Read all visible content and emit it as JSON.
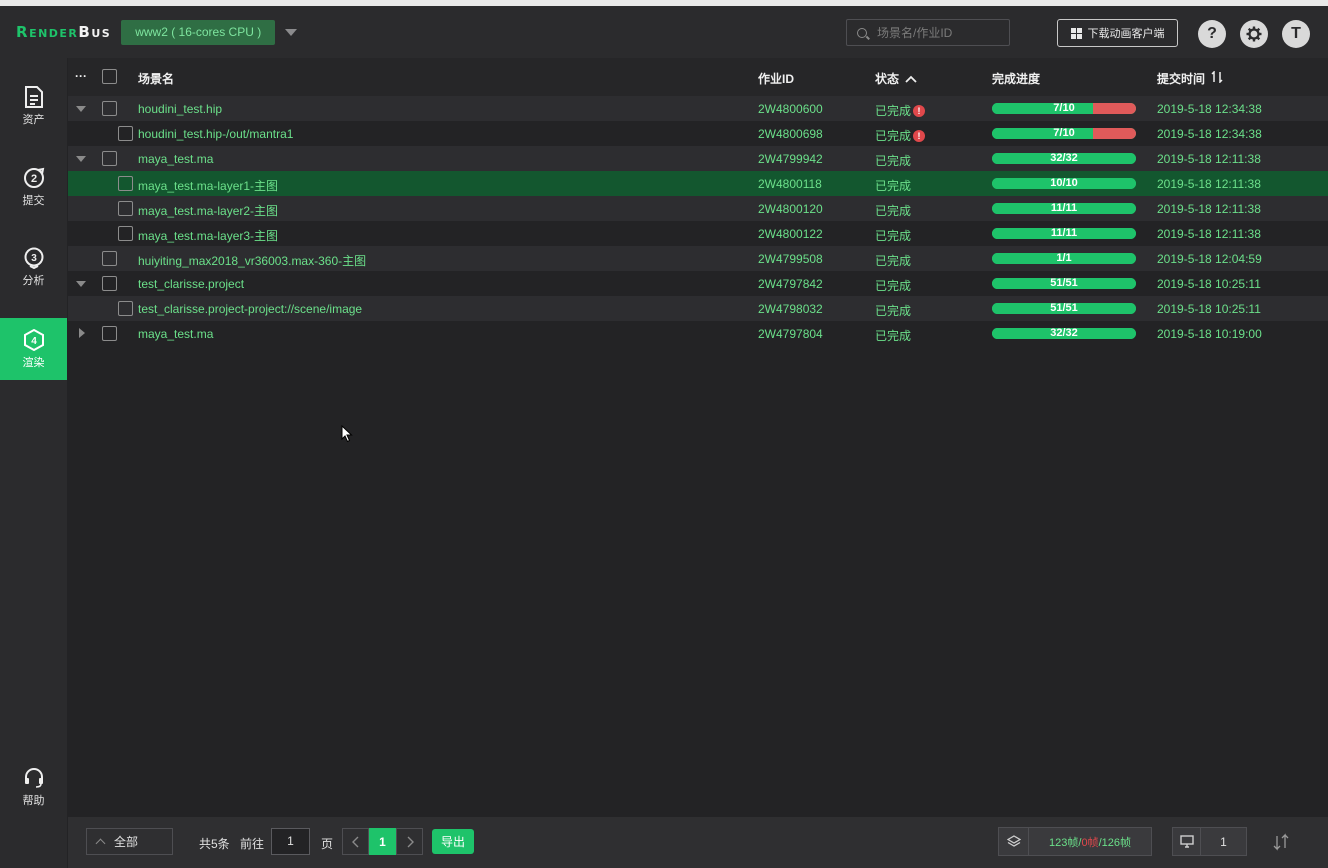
{
  "header": {
    "logo": {
      "r": "R",
      "ender": "ENDER",
      "b": "B",
      "us": "US"
    },
    "node_label": "www2 ( 16-cores CPU )",
    "search_placeholder": "场景名/作业ID",
    "download_label": "下载动画客户端",
    "help_label": "?",
    "avatar_label": "T"
  },
  "sidebar": {
    "items": [
      {
        "label": "资产",
        "icon": "asset-icon"
      },
      {
        "label": "提交",
        "icon": "submit-icon"
      },
      {
        "label": "分析",
        "icon": "analyze-icon"
      },
      {
        "label": "渲染",
        "icon": "render-icon",
        "active": true
      }
    ],
    "help": {
      "label": "帮助",
      "icon": "headset-icon"
    }
  },
  "table": {
    "columns": {
      "more": "···",
      "name": "场景名",
      "job_id": "作业ID",
      "status": "状态",
      "progress": "完成进度",
      "time": "提交时间"
    },
    "rows": [
      {
        "expand": "down",
        "indent": false,
        "name": "houdini_test.hip",
        "job_id": "2W4800600",
        "status": "已完成",
        "warn": true,
        "progress": "7/10",
        "done": 7,
        "total": 10,
        "time": "2019-5-18 12:34:38"
      },
      {
        "expand": "none",
        "indent": true,
        "name": "houdini_test.hip-/out/mantra1",
        "job_id": "2W4800698",
        "status": "已完成",
        "warn": true,
        "progress": "7/10",
        "done": 7,
        "total": 10,
        "time": "2019-5-18 12:34:38"
      },
      {
        "expand": "down",
        "indent": false,
        "name": "maya_test.ma",
        "job_id": "2W4799942",
        "status": "已完成",
        "warn": false,
        "progress": "32/32",
        "done": 32,
        "total": 32,
        "time": "2019-5-18 12:11:38"
      },
      {
        "expand": "none",
        "indent": true,
        "selected": true,
        "name": "maya_test.ma-layer1-主图",
        "job_id": "2W4800118",
        "status": "已完成",
        "warn": false,
        "progress": "10/10",
        "done": 10,
        "total": 10,
        "time": "2019-5-18 12:11:38"
      },
      {
        "expand": "none",
        "indent": true,
        "name": "maya_test.ma-layer2-主图",
        "job_id": "2W4800120",
        "status": "已完成",
        "warn": false,
        "progress": "11/11",
        "done": 11,
        "total": 11,
        "time": "2019-5-18 12:11:38"
      },
      {
        "expand": "none",
        "indent": true,
        "name": "maya_test.ma-layer3-主图",
        "job_id": "2W4800122",
        "status": "已完成",
        "warn": false,
        "progress": "11/11",
        "done": 11,
        "total": 11,
        "time": "2019-5-18 12:11:38"
      },
      {
        "expand": "none",
        "indent": false,
        "name": "huiyiting_max2018_vr36003.max-360-主图",
        "job_id": "2W4799508",
        "status": "已完成",
        "warn": false,
        "progress": "1/1",
        "done": 1,
        "total": 1,
        "time": "2019-5-18 12:04:59"
      },
      {
        "expand": "down",
        "indent": false,
        "name": "test_clarisse.project",
        "job_id": "2W4797842",
        "status": "已完成",
        "warn": false,
        "progress": "51/51",
        "done": 51,
        "total": 51,
        "time": "2019-5-18 10:25:11"
      },
      {
        "expand": "none",
        "indent": true,
        "name": "test_clarisse.project-project://scene/image",
        "job_id": "2W4798032",
        "status": "已完成",
        "warn": false,
        "progress": "51/51",
        "done": 51,
        "total": 51,
        "time": "2019-5-18 10:25:11"
      },
      {
        "expand": "right",
        "indent": false,
        "name": "maya_test.ma",
        "job_id": "2W4797804",
        "status": "已完成",
        "warn": false,
        "progress": "32/32",
        "done": 32,
        "total": 32,
        "time": "2019-5-18 10:19:00"
      }
    ]
  },
  "footer": {
    "filter_value": "全部",
    "total_text": "共5条",
    "goto_text": "前往",
    "page_input": "1",
    "page_unit": "页",
    "current_page": "1",
    "export_label": "导出",
    "frames": {
      "done": "123帧",
      "sep1": "/",
      "failed": "0帧",
      "sep2": "/",
      "total": "126帧"
    },
    "machines": "1"
  },
  "colors": {
    "accent": "#1ec36a",
    "danger": "#e05a5a",
    "text_green": "#6be08a",
    "selected_row": "#13572f"
  }
}
